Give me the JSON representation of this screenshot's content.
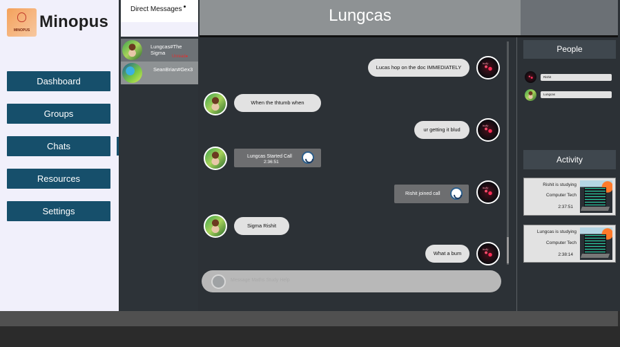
{
  "app": {
    "brand": "Minopus",
    "logo_caption": "MINOPUS"
  },
  "nav": {
    "items": [
      {
        "label": "Dashboard"
      },
      {
        "label": "Groups"
      },
      {
        "label": "Chats"
      },
      {
        "label": "Resources"
      },
      {
        "label": "Settings"
      }
    ],
    "active": "Chats"
  },
  "dm": {
    "title": "Direct Messages",
    "conversations": [
      {
        "name": "Lungcas#The Sigma",
        "badge": "Unread●"
      },
      {
        "name": "SeanBrian#Gex3",
        "badge": ""
      }
    ]
  },
  "chat": {
    "title": "Lungcas",
    "messages": [
      {
        "text": "Lucas hop on the doc IMMEDIATELY",
        "side": "right"
      },
      {
        "text": "When the thtumb when",
        "side": "left"
      },
      {
        "text": "ur getting it blud",
        "side": "right"
      },
      {
        "text": "Lungcas Started Call",
        "time": "2:36:51",
        "side": "left",
        "kind": "call"
      },
      {
        "text": "Rishit joined call",
        "side": "right",
        "kind": "call"
      },
      {
        "text": "Sigma Rishit",
        "side": "left"
      },
      {
        "text": "What a bum",
        "side": "right"
      }
    ],
    "input_placeholder": "Message Maths Study Help"
  },
  "people": {
    "title": "People",
    "list": [
      {
        "name": "Rishit"
      },
      {
        "name": "Lungcas"
      }
    ]
  },
  "activity": {
    "title": "Activity",
    "items": [
      {
        "line1": "Rishit is studying",
        "line2": "Computer Tech",
        "time": "2:37:51"
      },
      {
        "line1": "Lungcas is studying",
        "line2": "Computer Tech",
        "time": "2:38:14"
      }
    ]
  },
  "colors": {
    "nav_button": "#164f6b",
    "chat_bg": "#2c3136",
    "bubble": "#e2e2e2",
    "unread": "#e03030"
  }
}
